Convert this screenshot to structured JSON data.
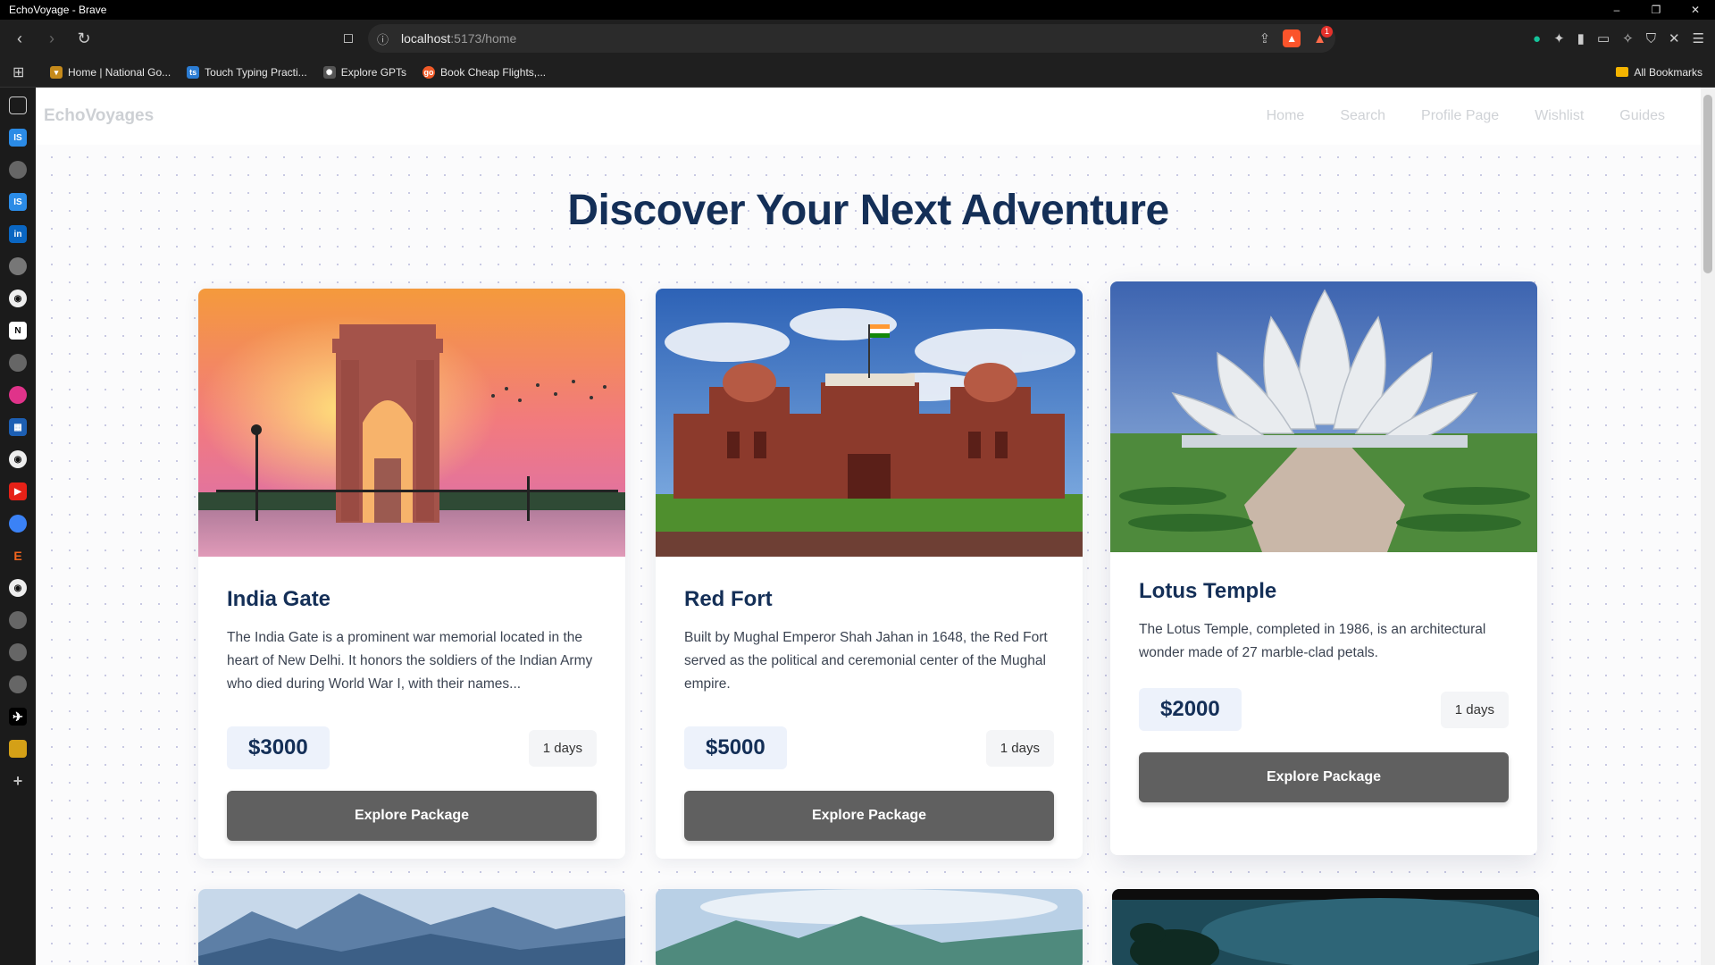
{
  "window": {
    "title": "EchoVoyage - Brave",
    "controls": [
      "–",
      "❐",
      "✕"
    ]
  },
  "address_bar": {
    "host": "localhost",
    "path": ":5173/home"
  },
  "bookmarks": {
    "items": [
      {
        "label": "Home | National Go...",
        "icon": "trophy-icon",
        "color": "#c58a1b"
      },
      {
        "label": "Touch Typing Practi...",
        "icon": "ts-icon",
        "color": "#2b7cd3"
      },
      {
        "label": "Explore GPTs",
        "icon": "openai-icon",
        "color": "#555555"
      },
      {
        "label": "Book Cheap Flights,...",
        "icon": "go-icon",
        "color": "#f05a28"
      }
    ],
    "all_label": "All Bookmarks"
  },
  "alert_count": "1",
  "app": {
    "brand": "EchoVoyages",
    "nav": [
      "Home",
      "Search",
      "Profile Page",
      "Wishlist",
      "Guides"
    ],
    "hero_title": "Discover Your Next Adventure",
    "cards": [
      {
        "title": "India Gate",
        "description": "The India Gate is a prominent war memorial located in the heart of New Delhi. It honors the soldiers of the Indian Army who died during World War I, with their names...",
        "price": "$3000",
        "duration": "1 days",
        "cta": "Explore Package",
        "image": "india-gate-photo"
      },
      {
        "title": "Red Fort",
        "description": "Built by Mughal Emperor Shah Jahan in 1648, the Red Fort served as the political and ceremonial center of the Mughal empire.",
        "price": "$5000",
        "duration": "1 days",
        "cta": "Explore Package",
        "image": "red-fort-photo"
      },
      {
        "title": "Lotus Temple",
        "description": "The Lotus Temple, completed in 1986, is an architectural wonder made of 27 marble-clad petals.",
        "price": "$2000",
        "duration": "1 days",
        "cta": "Explore Package",
        "image": "lotus-temple-photo"
      }
    ]
  },
  "colors": {
    "heading": "#142f57",
    "button": "#606060",
    "price_bg": "#edf2fb"
  }
}
